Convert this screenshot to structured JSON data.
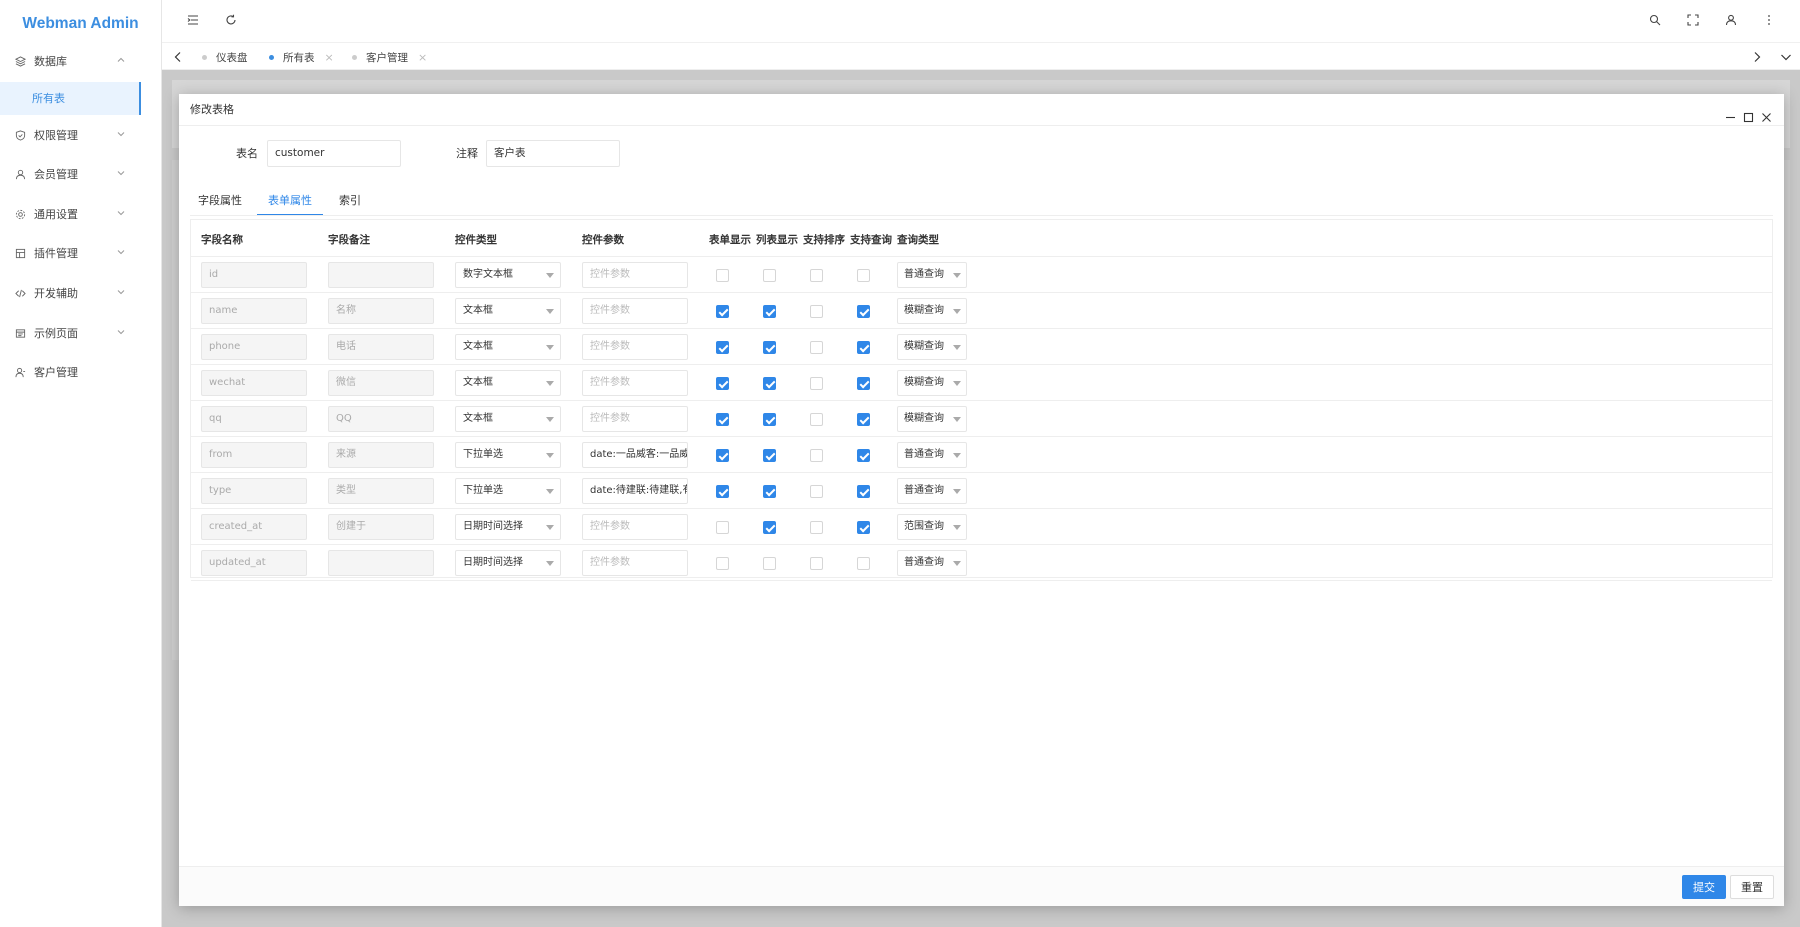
{
  "app": {
    "title": "Webman Admin"
  },
  "sidebar": {
    "items": [
      {
        "label": "数据库",
        "icon": "database-icon",
        "expanded": true
      },
      {
        "label": "权限管理",
        "icon": "shield-icon"
      },
      {
        "label": "会员管理",
        "icon": "user-icon"
      },
      {
        "label": "通用设置",
        "icon": "gear-icon"
      },
      {
        "label": "插件管理",
        "icon": "plugin-icon"
      },
      {
        "label": "开发辅助",
        "icon": "code-icon"
      },
      {
        "label": "示例页面",
        "icon": "layout-icon"
      },
      {
        "label": "客户管理",
        "icon": "customer-icon"
      }
    ],
    "sub_active": "所有表"
  },
  "tabs": [
    {
      "label": "仪表盘",
      "closable": false
    },
    {
      "label": "所有表",
      "closable": true,
      "active": true
    },
    {
      "label": "客户管理",
      "closable": true
    }
  ],
  "modal": {
    "title": "修改表格",
    "table_name_label": "表名",
    "table_name_value": "customer",
    "comment_label": "注释",
    "comment_value": "客户表",
    "subtabs": [
      "字段属性",
      "表单属性",
      "索引"
    ],
    "active_subtab": "表单属性",
    "columns": [
      "字段名称",
      "字段备注",
      "控件类型",
      "控件参数",
      "表单显示",
      "列表显示",
      "支持排序",
      "支持查询",
      "查询类型"
    ],
    "rows": [
      {
        "field": "id",
        "remark": "",
        "control": "数字文本框",
        "param": "",
        "form": false,
        "list": false,
        "sort": false,
        "search": false,
        "query": "普通查询"
      },
      {
        "field": "name",
        "remark": "名称",
        "control": "文本框",
        "param": "",
        "form": true,
        "list": true,
        "sort": false,
        "search": true,
        "query": "模糊查询"
      },
      {
        "field": "phone",
        "remark": "电话",
        "control": "文本框",
        "param": "",
        "form": true,
        "list": true,
        "sort": false,
        "search": true,
        "query": "模糊查询"
      },
      {
        "field": "wechat",
        "remark": "微信",
        "control": "文本框",
        "param": "",
        "form": true,
        "list": true,
        "sort": false,
        "search": true,
        "query": "模糊查询"
      },
      {
        "field": "qq",
        "remark": "QQ",
        "control": "文本框",
        "param": "",
        "form": true,
        "list": true,
        "sort": false,
        "search": true,
        "query": "模糊查询"
      },
      {
        "field": "from",
        "remark": "来源",
        "control": "下拉单选",
        "param": "date:一品威客:一品威客",
        "form": true,
        "list": true,
        "sort": false,
        "search": true,
        "query": "普通查询"
      },
      {
        "field": "type",
        "remark": "类型",
        "control": "下拉单选",
        "param": "date:待建联:待建联,有",
        "form": true,
        "list": true,
        "sort": false,
        "search": true,
        "query": "普通查询"
      },
      {
        "field": "created_at",
        "remark": "创建于",
        "control": "日期时间选择",
        "param": "",
        "form": false,
        "list": true,
        "sort": false,
        "search": true,
        "query": "范围查询"
      },
      {
        "field": "updated_at",
        "remark": "",
        "control": "日期时间选择",
        "param": "",
        "form": false,
        "list": false,
        "sort": false,
        "search": false,
        "query": "普通查询"
      }
    ],
    "param_placeholder": "控件参数",
    "submit_label": "提交",
    "reset_label": "重置"
  },
  "colors": {
    "accent": "#2f87e8",
    "brand": "#3c8ee0",
    "backdrop": "#c9c9c9"
  }
}
